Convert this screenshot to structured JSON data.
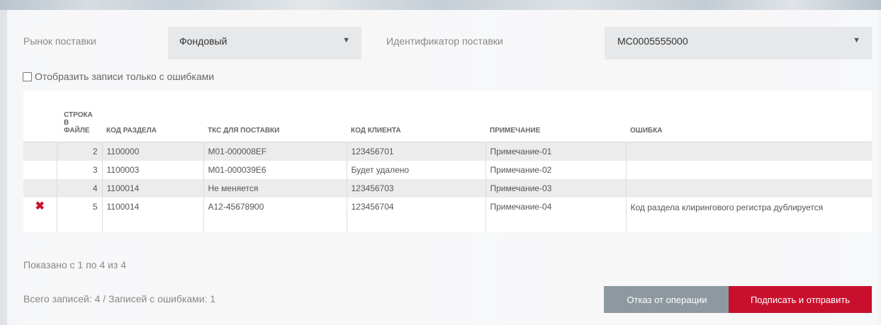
{
  "filters": {
    "market_label": "Рынок поставки",
    "market_value": "Фондовый",
    "id_label": "Идентификатор поставки",
    "id_value": "MC0005555000"
  },
  "checkbox": {
    "label": "Отобразить записи только с ошибками",
    "checked": false
  },
  "table": {
    "headers": [
      "СТРОКА\nВ\nФАЙЛЕ",
      "КОД РАЗДЕЛА",
      "ТКС ДЛЯ ПОСТАВКИ",
      "КОД КЛИЕНТА",
      "ПРИМЕЧАНИЕ",
      "ОШИБКА"
    ],
    "rows": [
      {
        "line": "2",
        "section": "1100000",
        "tks": "M01-000008EF",
        "client": "123456701",
        "note": "Примечание-01",
        "error": "",
        "has_error": false
      },
      {
        "line": "3",
        "section": "1100003",
        "tks": "M01-000039E6",
        "client": "Будет удалено",
        "note": "Примечание-02",
        "error": "",
        "has_error": false
      },
      {
        "line": "4",
        "section": "1100014",
        "tks": "Не меняется",
        "client": "123456703",
        "note": "Примечание-03",
        "error": "",
        "has_error": false
      },
      {
        "line": "5",
        "section": "1100014",
        "tks": "A12-45678900",
        "client": "123456704",
        "note": "Примечание-04",
        "error": "Код раздела клирингового регистра дублируется",
        "has_error": true
      }
    ]
  },
  "pagination_text": "Показано с 1 по 4 из 4",
  "summary_text": "Всего записей: 4 / Записей с ошибками: 1",
  "buttons": {
    "cancel_label": "Отказ от операции",
    "submit_label": "Подписать и отправить"
  },
  "icons": {
    "error": "close-x-icon",
    "dropdown": "caret-down-icon"
  },
  "colors": {
    "accent": "#c8102e",
    "secondary_button": "#8e999f"
  }
}
